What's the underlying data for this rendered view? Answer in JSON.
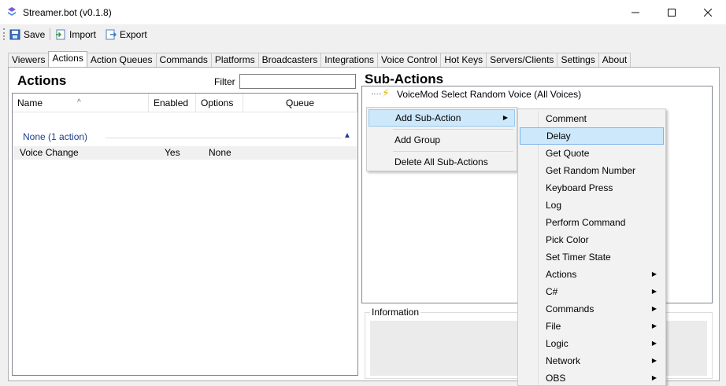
{
  "window": {
    "title": "Streamer.bot (v0.1.8)"
  },
  "toolbar": {
    "save_label": "Save",
    "import_label": "Import",
    "export_label": "Export"
  },
  "tabs": [
    {
      "label": "Viewers"
    },
    {
      "label": "Actions"
    },
    {
      "label": "Action Queues"
    },
    {
      "label": "Commands"
    },
    {
      "label": "Platforms"
    },
    {
      "label": "Broadcasters"
    },
    {
      "label": "Integrations"
    },
    {
      "label": "Voice Control"
    },
    {
      "label": "Hot Keys"
    },
    {
      "label": "Servers/Clients"
    },
    {
      "label": "Settings"
    },
    {
      "label": "About"
    }
  ],
  "actions_panel": {
    "title": "Actions",
    "filter_label": "Filter",
    "filter_value": "",
    "columns": {
      "name": "Name",
      "enabled": "Enabled",
      "options": "Options",
      "queue": "Queue"
    },
    "group": {
      "label": "None (1 action)"
    },
    "rows": [
      {
        "name": "Voice Change",
        "enabled": "Yes",
        "options": "None",
        "queue": ""
      }
    ]
  },
  "subactions_panel": {
    "title": "Sub-Actions",
    "items": [
      {
        "label": "VoiceMod Select Random Voice (All Voices)"
      }
    ],
    "info_label": "Information"
  },
  "context_menu": {
    "items": [
      {
        "label": "Add Sub-Action",
        "has_submenu": true
      },
      {
        "label": "Add Group"
      },
      {
        "label": "Delete All Sub-Actions"
      }
    ]
  },
  "submenu": {
    "items": [
      {
        "label": "Comment"
      },
      {
        "label": "Delay"
      },
      {
        "label": "Get Quote"
      },
      {
        "label": "Get Random Number"
      },
      {
        "label": "Keyboard Press"
      },
      {
        "label": "Log"
      },
      {
        "label": "Perform Command"
      },
      {
        "label": "Pick Color"
      },
      {
        "label": "Set Timer State"
      },
      {
        "label": "Actions"
      },
      {
        "label": "C#"
      },
      {
        "label": "Commands"
      },
      {
        "label": "File"
      },
      {
        "label": "Logic"
      },
      {
        "label": "Network"
      },
      {
        "label": "OBS"
      }
    ]
  },
  "colors": {
    "accent": "#1e3d8f",
    "highlight": "#cde8fb",
    "bolt": "#e9b800"
  }
}
